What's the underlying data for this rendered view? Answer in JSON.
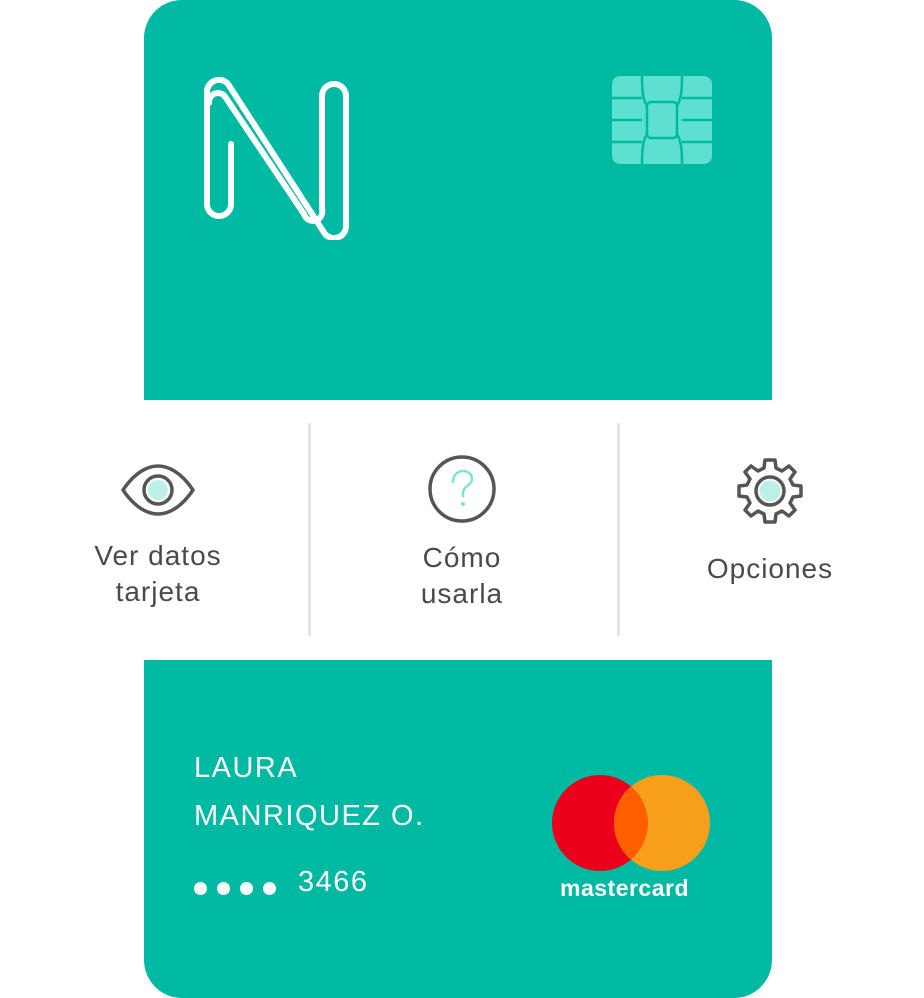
{
  "card": {
    "brand_logo": "n-logo",
    "chip_icon": "chip-icon",
    "colors": {
      "card": "#00b9a3",
      "chip": "#5de0cf",
      "accent_icon": "#7de3d6",
      "icon_stroke": "#555555",
      "text_muted": "#4a4a4a"
    },
    "holder_first": "LAURA",
    "holder_last": "MANRIQUEZ O.",
    "masked_number": "3466",
    "network": "mastercard",
    "network_colors": {
      "red": "#eb001b",
      "orange": "#f79e1b",
      "overlap": "#ff5f00"
    }
  },
  "actions": [
    {
      "icon": "eye-icon",
      "line1": "Ver datos",
      "line2": "tarjeta"
    },
    {
      "icon": "question-circle-icon",
      "line1": "Cómo",
      "line2": "usarla"
    },
    {
      "icon": "gear-icon",
      "line1": "Opciones",
      "line2": ""
    }
  ]
}
